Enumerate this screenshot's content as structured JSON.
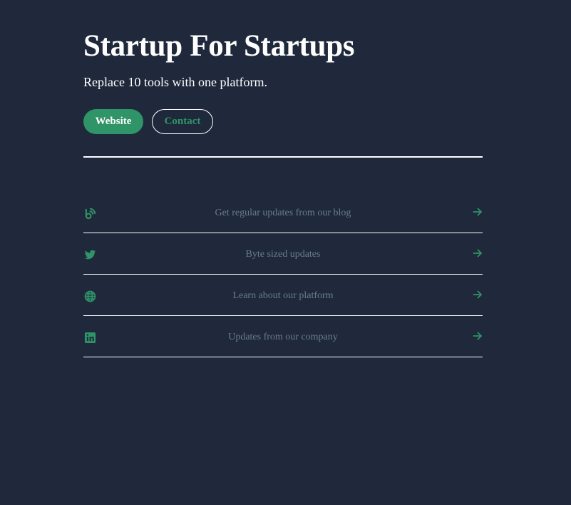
{
  "header": {
    "title": "Startup For Startups",
    "tagline": "Replace 10 tools with one platform."
  },
  "buttons": {
    "website_label": "Website",
    "contact_label": "Contact"
  },
  "links": [
    {
      "icon": "blog-icon",
      "label": "Get regular updates from our blog"
    },
    {
      "icon": "twitter-icon",
      "label": "Byte sized updates"
    },
    {
      "icon": "globe-icon",
      "label": "Learn about our platform"
    },
    {
      "icon": "linkedin-icon",
      "label": "Updates from our company"
    }
  ],
  "colors": {
    "background": "#1f293b",
    "accent": "#2f9467",
    "muted_text": "#6a7b91",
    "text": "#ffffff"
  }
}
